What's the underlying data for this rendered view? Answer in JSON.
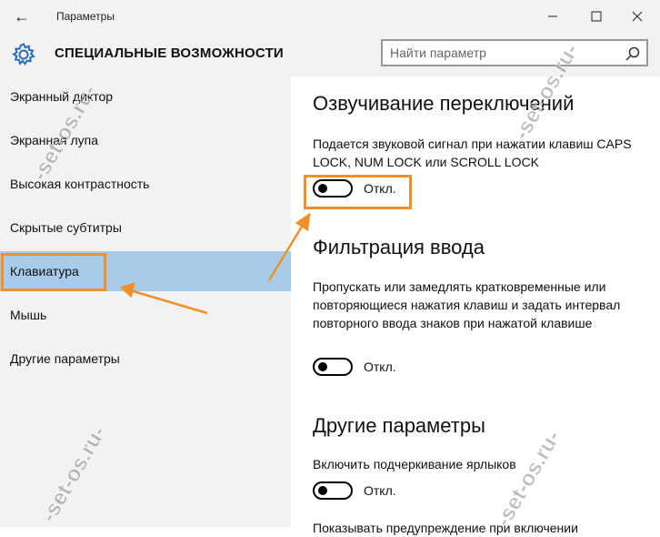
{
  "window": {
    "back_glyph": "←",
    "title": "Параметры",
    "minimize_glyph": "—",
    "maximize_glyph": "☐",
    "close_glyph": "✕"
  },
  "header": {
    "section_title": "СПЕЦИАЛЬНЫЕ ВОЗМОЖНОСТИ",
    "search_placeholder": "Найти параметр"
  },
  "sidebar": {
    "items": [
      {
        "label": "Экранный диктор"
      },
      {
        "label": "Экранная лупа"
      },
      {
        "label": "Высокая контрастность"
      },
      {
        "label": "Скрытые субтитры"
      },
      {
        "label": "Клавиатура"
      },
      {
        "label": "Мышь"
      },
      {
        "label": "Другие параметры"
      }
    ],
    "active_index": 4
  },
  "content": {
    "sections": [
      {
        "heading": "Озвучивание переключений",
        "description": "Подается звуковой сигнал при нажатии клавиш CAPS LOCK, NUM LOCK или SCROLL LOCK",
        "toggle_state": "Откл."
      },
      {
        "heading": "Фильтрация ввода",
        "description": "Пропускать или замедлять кратковременные или повторяющиеся нажатия клавиш и задать интервал повторного ввода знаков при нажатой клавише",
        "toggle_state": "Откл."
      },
      {
        "heading": "Другие параметры",
        "description": "Включить подчеркивание ярлыков",
        "toggle_state": "Откл."
      }
    ],
    "cut_off_text": "Показывать предупреждение при включении"
  },
  "annotations": {
    "highlight_color": "#f0902a",
    "active_nav_color": "#a8cbea"
  },
  "watermark": "-set-os.ru-",
  "icons": [
    "back-arrow-icon",
    "minimize-icon",
    "maximize-icon",
    "close-icon",
    "gear-icon",
    "search-icon"
  ]
}
